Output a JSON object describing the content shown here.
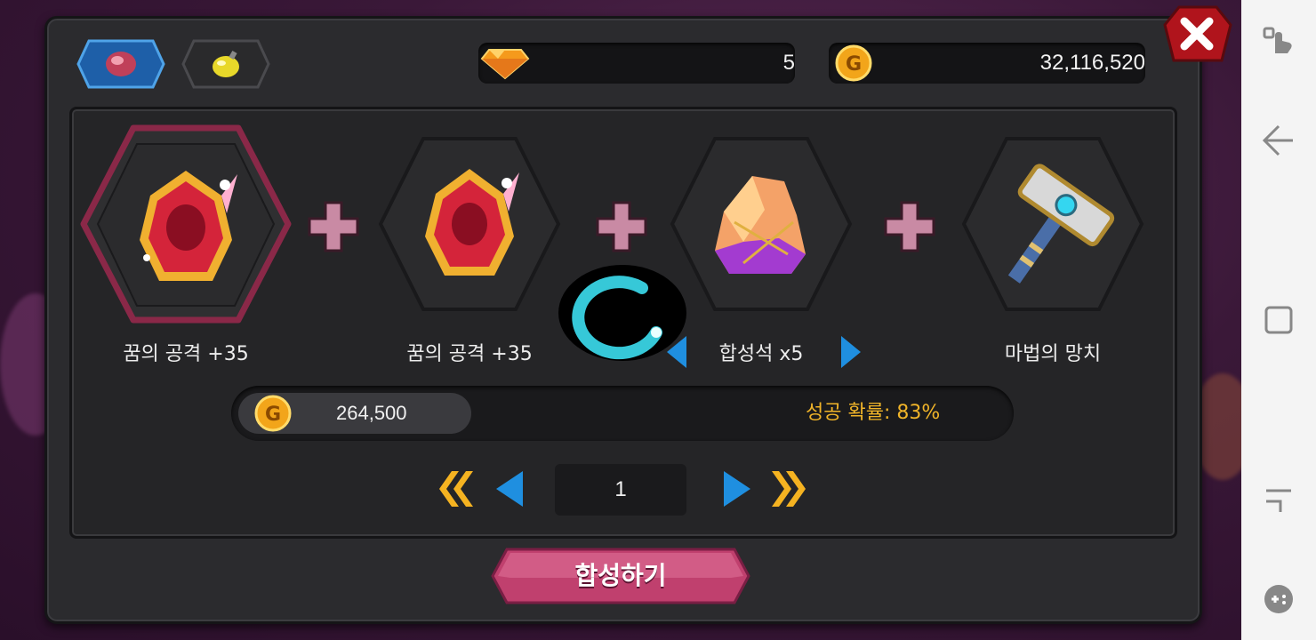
{
  "tabs": [
    {
      "icon": "ruby-gem-icon",
      "active": true
    },
    {
      "icon": "yellow-bomb-icon",
      "active": false
    }
  ],
  "currency": {
    "diamond": {
      "icon": "diamond-icon",
      "value": "5"
    },
    "gold": {
      "icon": "gold-coin-icon",
      "value": "32,116,520"
    }
  },
  "items": [
    {
      "label": "꿈의 공격 +35",
      "icon": "red-dream-gem-icon",
      "selected": true
    },
    {
      "label": "꿈의 공격 +35",
      "icon": "red-dream-gem-icon",
      "selected": false
    },
    {
      "label": "합성석 x5",
      "icon": "synthesis-stone-icon",
      "selected": false
    },
    {
      "label": "마법의 망치",
      "icon": "magic-hammer-icon",
      "selected": false
    }
  ],
  "cost": {
    "value": "264,500"
  },
  "success_rate": "성공 확률: 83%",
  "pagination": {
    "page": "1"
  },
  "synthesize_button": "합성하기",
  "colors": {
    "accent_pink": "#c0406e",
    "gold_text": "#f0b429",
    "nav_blue": "#1f8fe0",
    "nav_gold": "#f5b321"
  }
}
